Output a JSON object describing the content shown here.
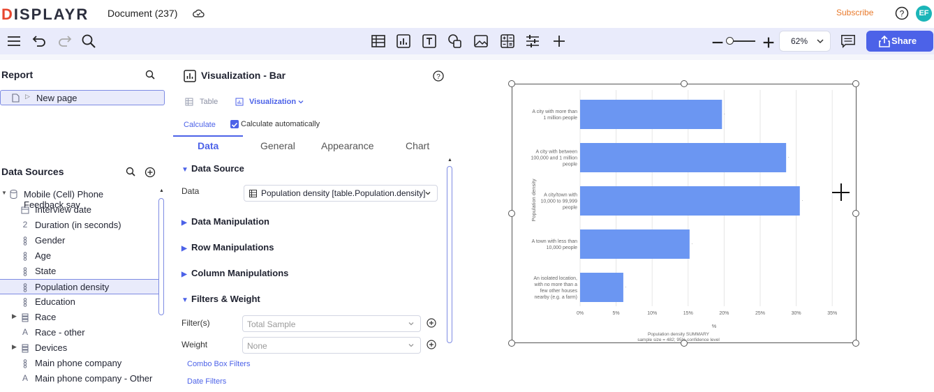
{
  "app": {
    "logo": "DISPLAYR",
    "document_title": "Document (237)",
    "subscribe": "Subscribe",
    "avatar": "EF"
  },
  "toolbar": {
    "zoom": "62%",
    "share": "Share",
    "icons": [
      "menu-icon",
      "undo-icon",
      "redo-icon",
      "search-icon",
      "table-icon",
      "chart-icon",
      "text-icon",
      "shapes-icon",
      "image-icon",
      "calculation-icon",
      "controls-icon",
      "add-icon",
      "zoom-out-icon",
      "zoom-in-icon",
      "comment-icon",
      "share-icon"
    ]
  },
  "report": {
    "title": "Report",
    "pages": [
      "New page"
    ]
  },
  "data_sources": {
    "title": "Data Sources",
    "file": "Mobile (Cell) Phone Feedback.sav",
    "variables": [
      {
        "label": "Interview date",
        "icon": "calendar"
      },
      {
        "label": "Duration (in seconds)",
        "icon": "2"
      },
      {
        "label": "Gender",
        "icon": "nominal"
      },
      {
        "label": "Age",
        "icon": "nominal"
      },
      {
        "label": "State",
        "icon": "nominal"
      },
      {
        "label": "Population density",
        "icon": "nominal",
        "selected": true
      },
      {
        "label": "Education",
        "icon": "nominal"
      },
      {
        "label": "Race",
        "icon": "nominal",
        "expandable": true
      },
      {
        "label": "Race - other",
        "icon": "A"
      },
      {
        "label": "Devices",
        "icon": "nominal",
        "expandable": true
      },
      {
        "label": "Main phone company",
        "icon": "nominal"
      },
      {
        "label": "Main phone company - Other",
        "icon": "A"
      }
    ]
  },
  "object_inspector": {
    "title": "Visualization - Bar",
    "crumb_table": "Table",
    "crumb_visualization": "Visualization",
    "calculate": "Calculate",
    "calculate_auto": "Calculate automatically",
    "tabs": [
      "Data",
      "General",
      "Appearance",
      "Chart"
    ],
    "sections": {
      "data_source": "Data Source",
      "data_manipulation": "Data Manipulation",
      "row_manipulations": "Row Manipulations",
      "column_manipulations": "Column Manipulations",
      "filters_weight": "Filters & Weight"
    },
    "data_label": "Data",
    "data_value": "Population density [table.Population.density]",
    "filters_label": "Filter(s)",
    "filters_value": "Total Sample",
    "weight_label": "Weight",
    "weight_value": "None",
    "combo_link": "Combo Box Filters",
    "date_link": "Date Filters"
  },
  "chart_data": {
    "type": "bar",
    "orientation": "horizontal",
    "categories": [
      [
        "A city with more than",
        "1 million people"
      ],
      [
        "A city with between",
        "100,000 and 1 million",
        "people"
      ],
      [
        "A city/town with",
        "10,000 to 99,999",
        "people"
      ],
      [
        "A town with less than",
        "10,000 people"
      ],
      [
        "An isolated location,",
        "with no more than a",
        "few other houses",
        "nearby (e.g. a farm)"
      ]
    ],
    "values": [
      19.7,
      28.6,
      30.5,
      15.2,
      6.0
    ],
    "x_ticks": [
      "0%",
      "5%",
      "10%",
      "15%",
      "20%",
      "25%",
      "30%",
      "35%"
    ],
    "xlim": [
      0,
      35
    ],
    "xlabel": "%",
    "ylabel": "Population density",
    "footer_1": "Population density SUMMARY",
    "footer_2": "sample size = 482; 95% confidence level",
    "bar_color": "#6b96f2",
    "grid": true
  }
}
